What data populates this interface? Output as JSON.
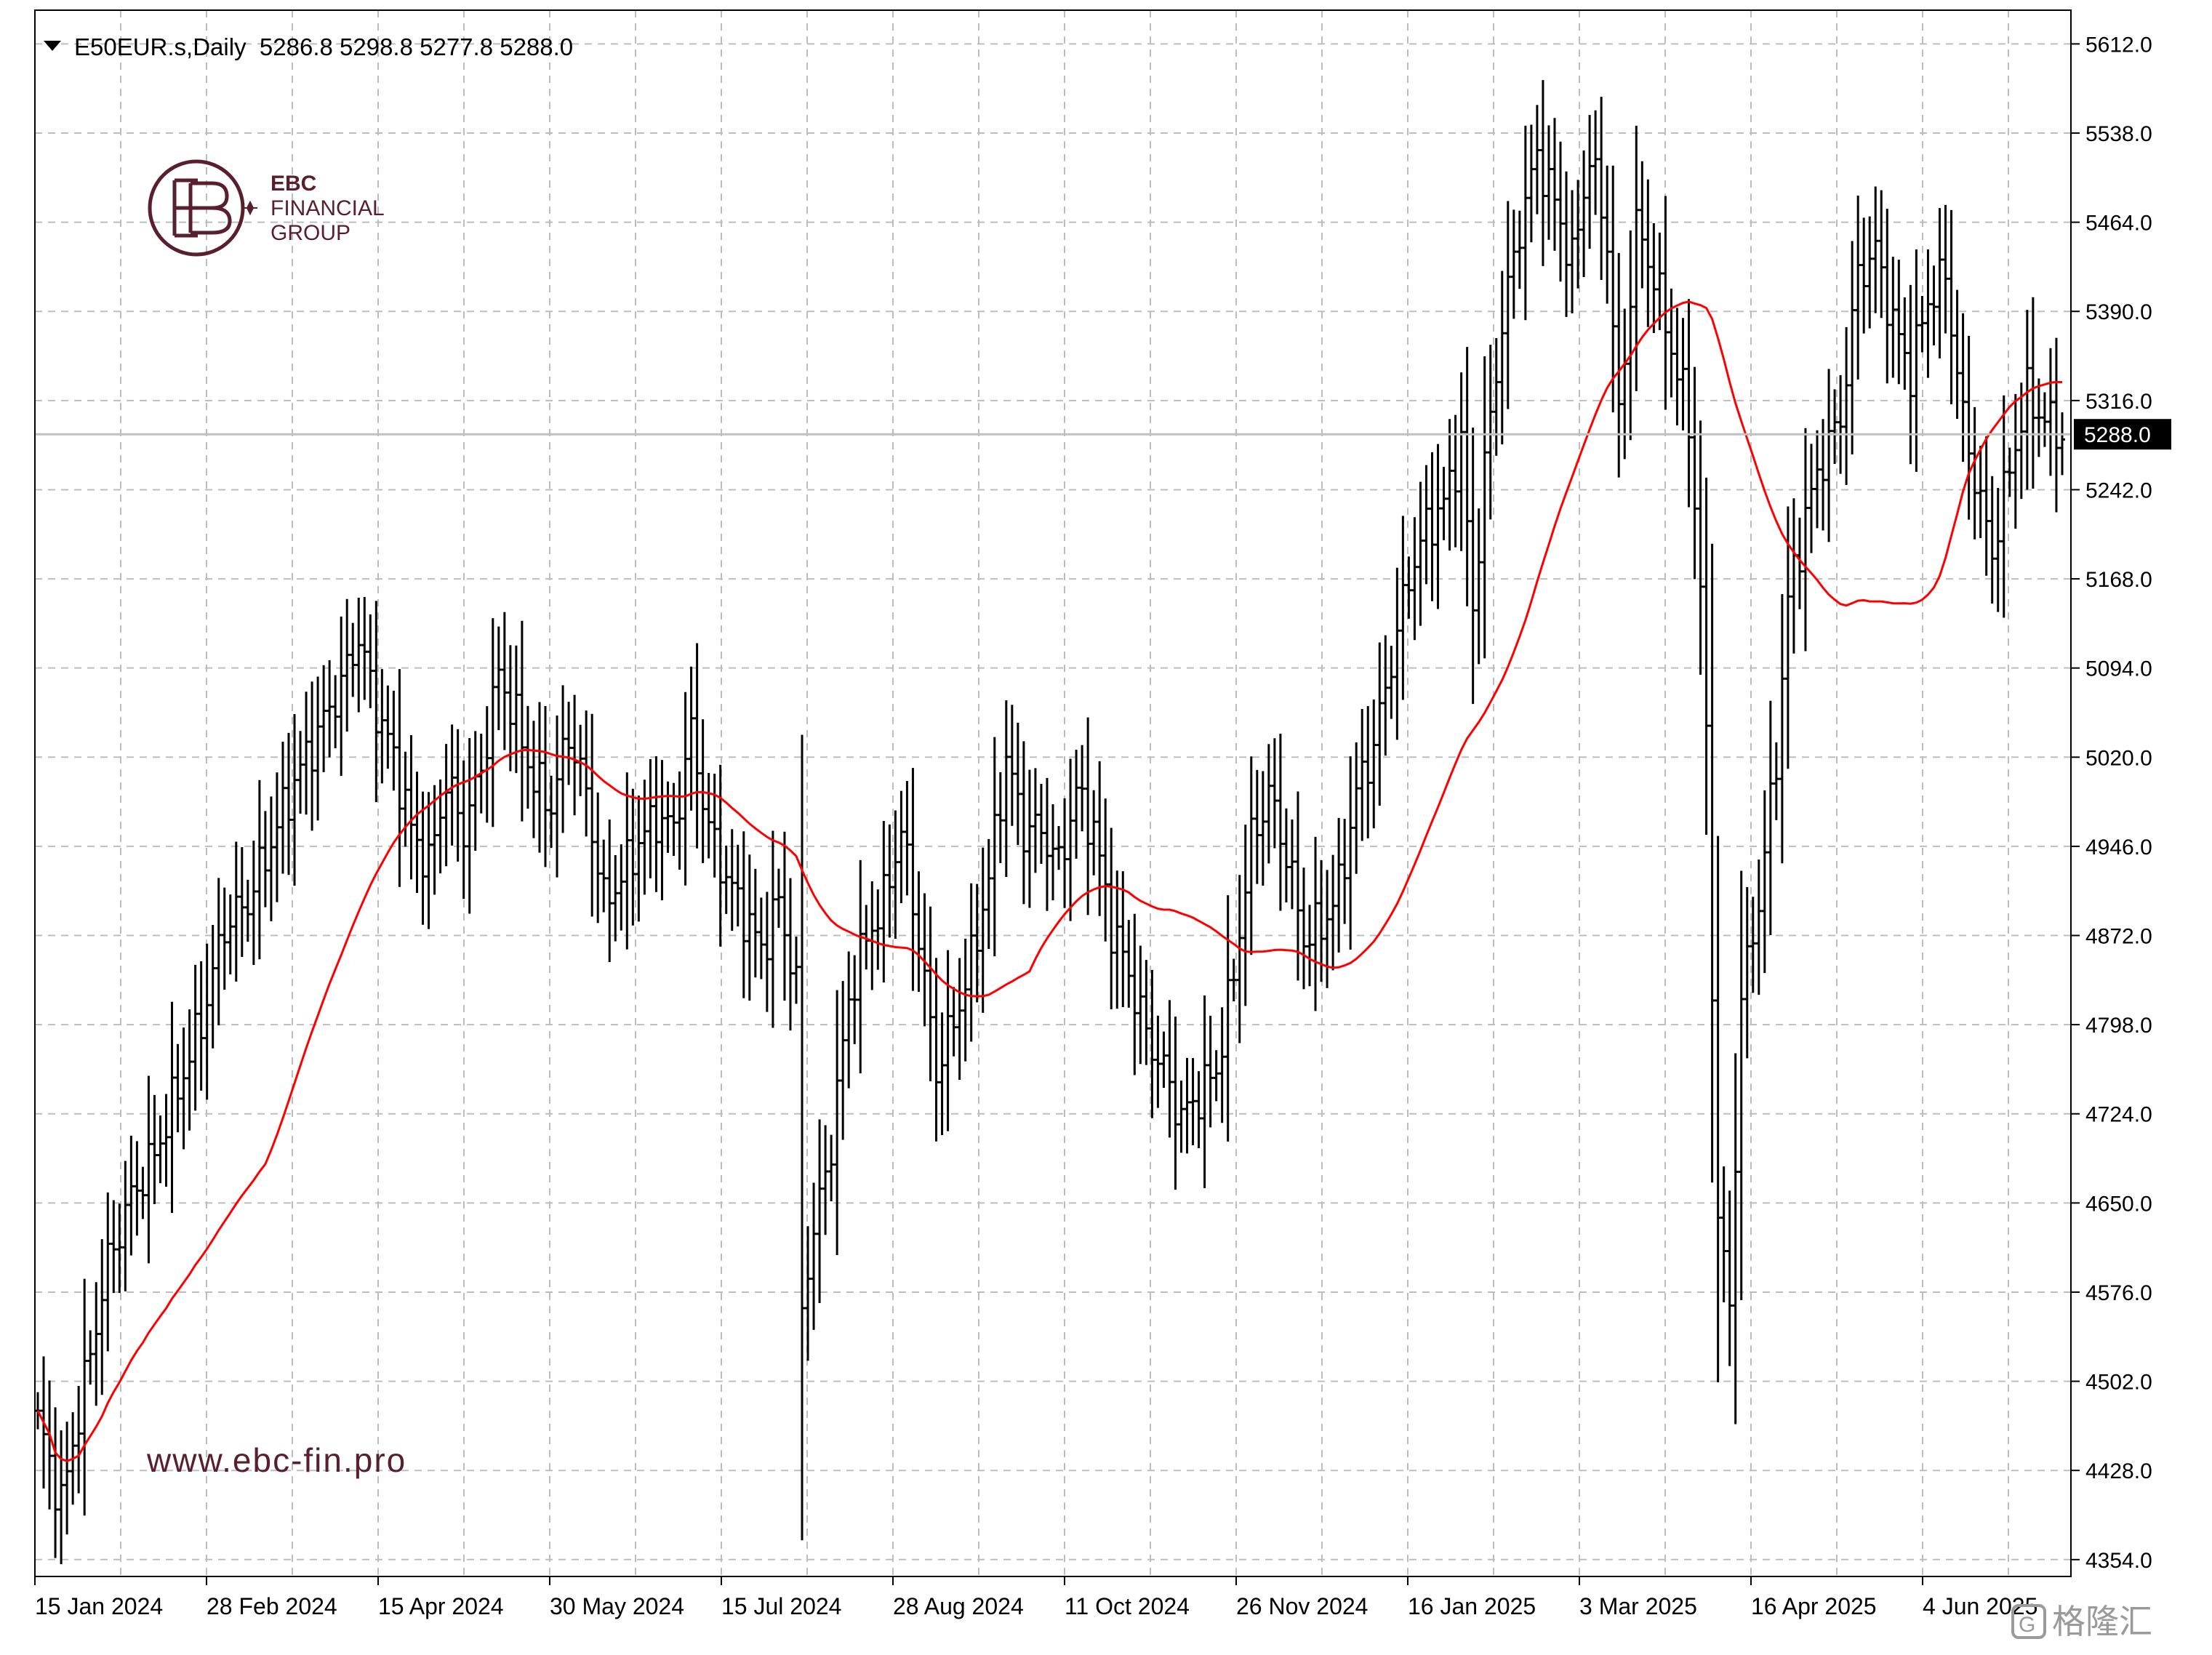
{
  "header": {
    "symbol_line": "E50EUR.s,Daily  5286.8 5298.8 5277.8 5288.0"
  },
  "brand": {
    "line1": "EBC",
    "line2": "FINANCIAL",
    "line3": "GROUP",
    "url": "www.ebc-fin.pro",
    "color": "#5a1f2e"
  },
  "corner_watermark": {
    "text": "格隆汇"
  },
  "chart_data": {
    "type": "ohlc",
    "timeframe": "Daily",
    "symbol": "E50EUR.s",
    "last_price": 5288.0,
    "last_price_label": "5288.0",
    "ylim": [
      4340,
      5640
    ],
    "y_ticks": [
      "5612.0",
      "5538.0",
      "5464.0",
      "5390.0",
      "5316.0",
      "5242.0",
      "5168.0",
      "5094.0",
      "5020.0",
      "4946.0",
      "4872.0",
      "4798.0",
      "4724.0",
      "4650.0",
      "4576.0",
      "4502.0",
      "4428.0",
      "4354.0"
    ],
    "x_ticks": [
      "15 Jan 2024",
      "28 Feb 2024",
      "15 Apr 2024",
      "30 May 2024",
      "15 Jul 2024",
      "28 Aug 2024",
      "11 Oct 2024",
      "26 Nov 2024",
      "16 Jan 2025",
      "3 Mar 2025",
      "16 Apr 2025",
      "4 Jun 2025"
    ],
    "grid": true,
    "bar_color": "#000000",
    "ma_color": "#ff0000",
    "price_line_color": "#c0c0c0",
    "price_anchors": [
      [
        0,
        4470
      ],
      [
        4,
        4400
      ],
      [
        8,
        4500
      ],
      [
        12,
        4600
      ],
      [
        16,
        4655
      ],
      [
        20,
        4690
      ],
      [
        24,
        4745
      ],
      [
        28,
        4800
      ],
      [
        32,
        4880
      ],
      [
        36,
        4900
      ],
      [
        40,
        4950
      ],
      [
        44,
        5000
      ],
      [
        48,
        5040
      ],
      [
        52,
        5080
      ],
      [
        55,
        5120
      ],
      [
        58,
        5060
      ],
      [
        61,
        5020
      ],
      [
        64,
        4960
      ],
      [
        67,
        4930
      ],
      [
        70,
        5000
      ],
      [
        73,
        4960
      ],
      [
        76,
        5010
      ],
      [
        79,
        5090
      ],
      [
        82,
        5050
      ],
      [
        85,
        5000
      ],
      [
        88,
        4980
      ],
      [
        91,
        5040
      ],
      [
        94,
        4990
      ],
      [
        97,
        4900
      ],
      [
        100,
        4920
      ],
      [
        103,
        4950
      ],
      [
        106,
        4970
      ],
      [
        109,
        4960
      ],
      [
        112,
        5040
      ],
      [
        115,
        4960
      ],
      [
        118,
        4920
      ],
      [
        121,
        4890
      ],
      [
        124,
        4860
      ],
      [
        127,
        4900
      ],
      [
        130,
        4830
      ],
      [
        131,
        4560
      ],
      [
        132,
        4600
      ],
      [
        136,
        4700
      ],
      [
        139,
        4820
      ],
      [
        142,
        4870
      ],
      [
        145,
        4900
      ],
      [
        148,
        4960
      ],
      [
        151,
        4870
      ],
      [
        154,
        4760
      ],
      [
        157,
        4800
      ],
      [
        160,
        4850
      ],
      [
        163,
        4920
      ],
      [
        166,
        5020
      ],
      [
        169,
        4960
      ],
      [
        172,
        4960
      ],
      [
        175,
        4930
      ],
      [
        178,
        4990
      ],
      [
        181,
        4960
      ],
      [
        184,
        4880
      ],
      [
        187,
        4840
      ],
      [
        190,
        4790
      ],
      [
        193,
        4760
      ],
      [
        196,
        4720
      ],
      [
        199,
        4740
      ],
      [
        202,
        4760
      ],
      [
        205,
        4840
      ],
      [
        208,
        4950
      ],
      [
        211,
        4990
      ],
      [
        214,
        4940
      ],
      [
        217,
        4870
      ],
      [
        220,
        4880
      ],
      [
        223,
        4910
      ],
      [
        226,
        4990
      ],
      [
        229,
        5030
      ],
      [
        232,
        5100
      ],
      [
        235,
        5170
      ],
      [
        238,
        5210
      ],
      [
        241,
        5230
      ],
      [
        244,
        5280
      ],
      [
        246,
        5140
      ],
      [
        248,
        5260
      ],
      [
        251,
        5380
      ],
      [
        254,
        5460
      ],
      [
        257,
        5520
      ],
      [
        260,
        5480
      ],
      [
        263,
        5430
      ],
      [
        266,
        5520
      ],
      [
        269,
        5450
      ],
      [
        271,
        5300
      ],
      [
        274,
        5460
      ],
      [
        277,
        5420
      ],
      [
        280,
        5360
      ],
      [
        283,
        5300
      ],
      [
        285,
        5160
      ],
      [
        286,
        5030
      ],
      [
        288,
        4640
      ],
      [
        290,
        4560
      ],
      [
        292,
        4820
      ],
      [
        295,
        4900
      ],
      [
        298,
        5020
      ],
      [
        300,
        5150
      ],
      [
        303,
        5220
      ],
      [
        306,
        5270
      ],
      [
        309,
        5300
      ],
      [
        312,
        5420
      ],
      [
        315,
        5440
      ],
      [
        318,
        5380
      ],
      [
        321,
        5340
      ],
      [
        324,
        5400
      ],
      [
        327,
        5420
      ],
      [
        330,
        5300
      ],
      [
        333,
        5230
      ],
      [
        335,
        5190
      ],
      [
        338,
        5260
      ],
      [
        341,
        5320
      ],
      [
        344,
        5300
      ],
      [
        347,
        5288
      ]
    ]
  }
}
